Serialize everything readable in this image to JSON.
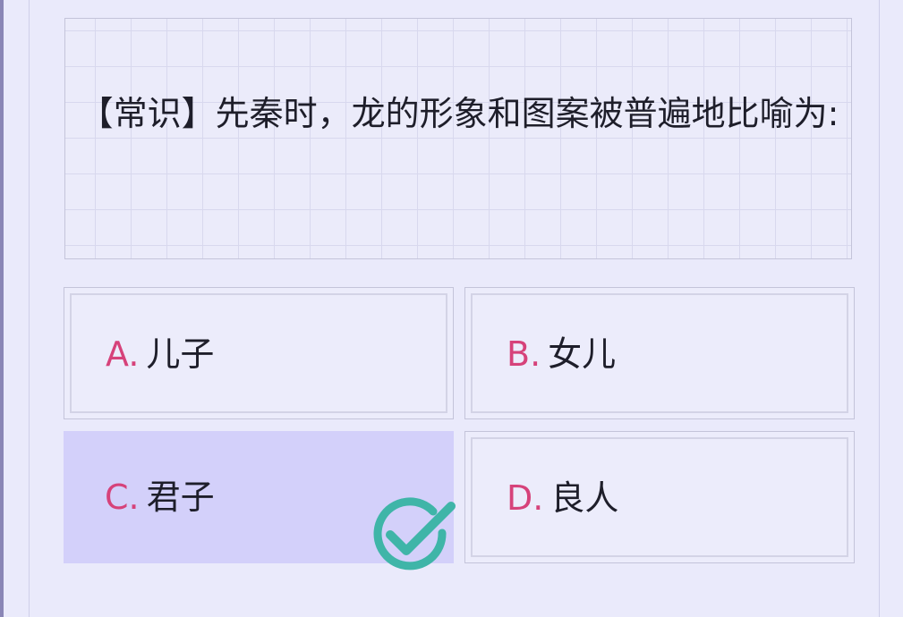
{
  "question": {
    "text": "【常识】先秦时，龙的形象和图案被普遍地比喻为:"
  },
  "options": [
    {
      "letter": "A",
      "text": "儿子",
      "selected": false
    },
    {
      "letter": "B",
      "text": "女儿",
      "selected": false
    },
    {
      "letter": "C",
      "text": "君子",
      "selected": true
    },
    {
      "letter": "D",
      "text": "良人",
      "selected": false
    }
  ],
  "colors": {
    "accent": "#d6427a",
    "selected_bg": "#d3d0fa",
    "check": "#3fb5a8",
    "background": "#eaeafb"
  },
  "icons": {
    "correct": "check-circle-icon"
  }
}
